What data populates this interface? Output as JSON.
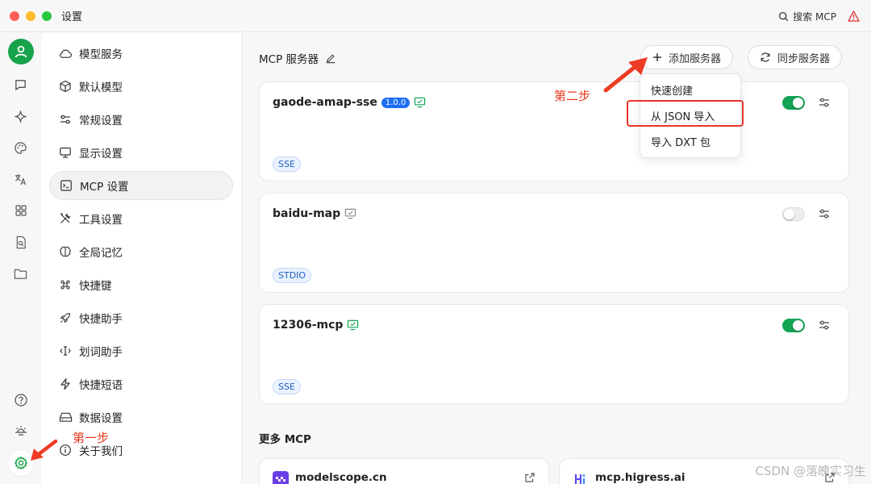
{
  "window": {
    "title": "设置",
    "search_label": "搜索 MCP"
  },
  "sidebar": {
    "items": [
      {
        "label": "模型服务"
      },
      {
        "label": "默认模型"
      },
      {
        "label": "常规设置"
      },
      {
        "label": "显示设置"
      },
      {
        "label": "MCP 设置",
        "selected": true
      },
      {
        "label": "工具设置"
      },
      {
        "label": "全局记忆"
      },
      {
        "label": "快捷键"
      },
      {
        "label": "快捷助手"
      },
      {
        "label": "划词助手"
      },
      {
        "label": "快捷短语"
      },
      {
        "label": "数据设置"
      },
      {
        "label": "关于我们"
      }
    ]
  },
  "main": {
    "header": "MCP 服务器",
    "add_button": "添加服务器",
    "sync_button": "同步服务器",
    "servers": [
      {
        "name": "gaode-amap-sse",
        "version": "1.0.0",
        "tag": "SSE",
        "enabled": true
      },
      {
        "name": "baidu-map",
        "version": "",
        "tag": "STDIO",
        "enabled": false
      },
      {
        "name": "12306-mcp",
        "version": "",
        "tag": "SSE",
        "enabled": true
      }
    ],
    "more_title": "更多 MCP",
    "links": [
      {
        "name": "modelscope.cn"
      },
      {
        "name": "mcp.higress.ai"
      }
    ]
  },
  "dropdown": {
    "items": [
      "快速创建",
      "从 JSON 导入",
      "导入 DXT 包"
    ]
  },
  "annotations": {
    "step1": "第一步",
    "step2": "第二步"
  },
  "watermark": "CSDN @落魄实习生",
  "colors": {
    "accent_green": "#13a454",
    "version_blue": "#1d6ef5",
    "annotation_red": "#e63a1f"
  }
}
